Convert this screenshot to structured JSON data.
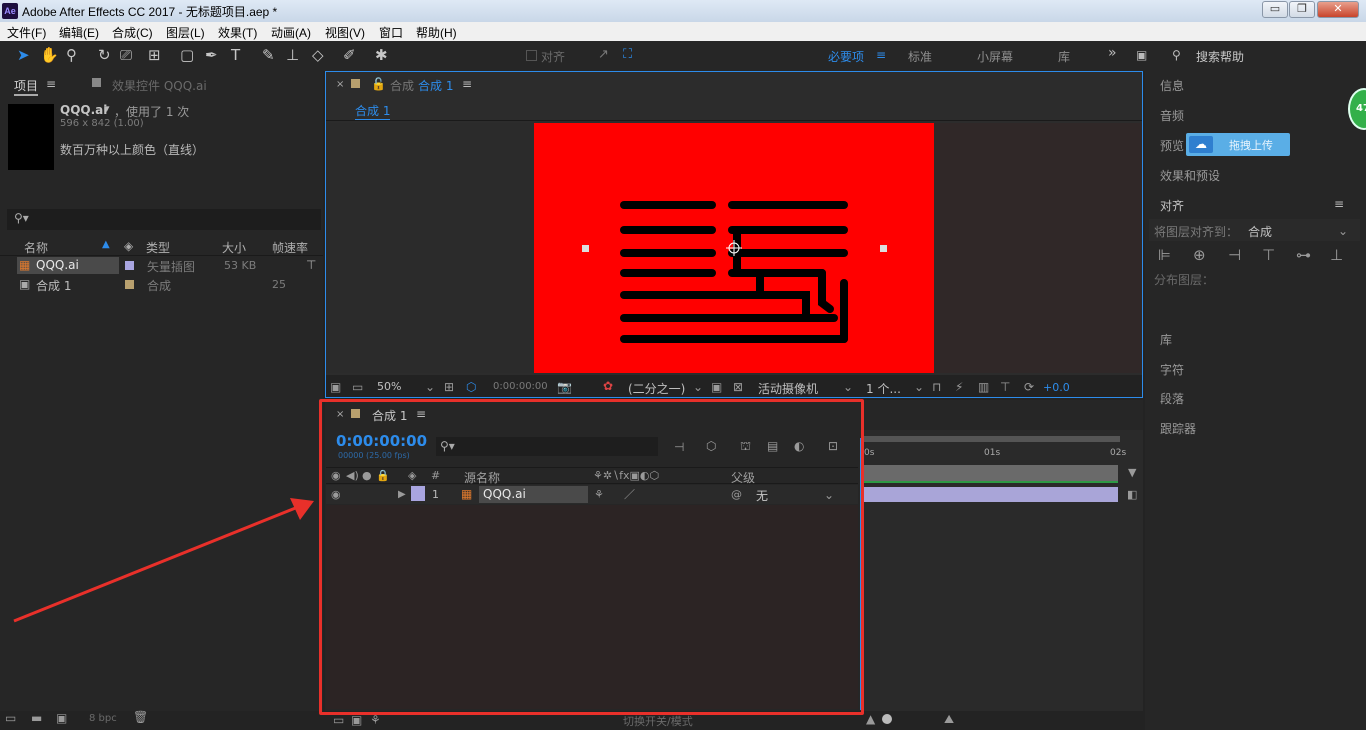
{
  "window": {
    "title": "Adobe After Effects CC 2017 - 无标题项目.aep *",
    "app_icon": "Ae",
    "minimize": "▭",
    "maximize": "❐",
    "close": "✕"
  },
  "menu": [
    "文件(F)",
    "编辑(E)",
    "合成(C)",
    "图层(L)",
    "效果(T)",
    "动画(A)",
    "视图(V)",
    "窗口",
    "帮助(H)"
  ],
  "toolbar": {
    "align_label": "对齐",
    "workspaces": [
      "必要项",
      "标准",
      "小屏幕",
      "库"
    ],
    "more": "»",
    "search_label": "搜索帮助"
  },
  "project": {
    "tab_project": "项目",
    "tab_effects": "效果控件 QQQ.ai",
    "selected_name": "QQQ.ai",
    "usage": "，使用了 1 次",
    "dimensions": "596 x 842 (1.00)",
    "color_info": "数百万种以上颜色（直线）",
    "search_placeholder": "",
    "columns": {
      "name": "名称",
      "type": "类型",
      "size": "大小",
      "fps": "帧速率"
    },
    "items": [
      {
        "name": "QQQ.ai",
        "type": "矢量插图",
        "size": "53 KB",
        "fps": ""
      },
      {
        "name": "合成 1",
        "type": "合成",
        "size": "",
        "fps": "25"
      }
    ],
    "bpc": "8 bpc"
  },
  "viewer": {
    "tab_prefix": "合成",
    "tab_name": "合成 1",
    "breadcrumb": "合成 1",
    "zoom": "50%",
    "timecode": "0:00:00:00",
    "resolution": "(二分之一)",
    "camera": "活动摄像机",
    "views": "1 个...",
    "exposure": "+0.0",
    "canvas_color": "#ff0000"
  },
  "timeline": {
    "tab_name": "合成 1",
    "timecode": "0:00:00:00",
    "fps_info": "00000 (25.00 fps)",
    "source_name_header": "源名称",
    "parent_header": "父级",
    "layer_number": "1",
    "layer_name": "QQQ.ai",
    "parent_value": "无",
    "ruler": [
      "0s",
      "01s",
      "02s"
    ],
    "bottom_label": "切换开关/模式"
  },
  "right_panel": {
    "info": "信息",
    "audio": "音频",
    "preview": "预览",
    "upload_button": "拖拽上传",
    "effects_presets": "效果和预设",
    "align": "对齐",
    "align_to_label": "将图层对齐到：",
    "align_to_value": "合成",
    "distribute": "分布图层：",
    "library": "库",
    "character": "字符",
    "paragraph": "段落",
    "tracker": "跟踪器",
    "badge": "47"
  },
  "annotation_color": "#e8302a"
}
